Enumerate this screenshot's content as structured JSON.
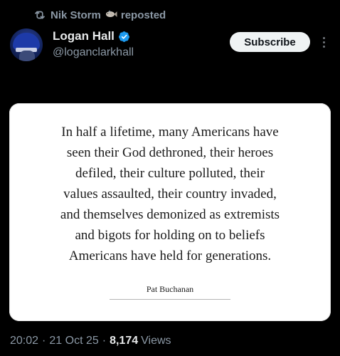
{
  "repost": {
    "user": "Nik Storm",
    "label": "reposted",
    "icon": "repost-icon",
    "emoji_icon": "fish-icon",
    "color": "#8b98a5"
  },
  "author": {
    "display_name": "Logan Hall",
    "handle": "@loganclarkhall",
    "verified_badge": "verified-badge-icon",
    "badge_color": "#1d9bf0"
  },
  "actions": {
    "subscribe_label": "Subscribe",
    "more_icon": "more-options-icon"
  },
  "image": {
    "quote_lines": [
      "In half a lifetime, many Americans have",
      "seen their God dethroned, their heroes",
      "defiled, their culture polluted, their",
      "values assaulted, their country invaded,",
      "and themselves demonized as extremists",
      "and bigots for holding on to beliefs",
      "Americans have held for generations."
    ],
    "attribution": "Pat Buchanan"
  },
  "meta": {
    "time": "20:02",
    "separator": "·",
    "date": "21 Oct 25",
    "views_count": "8,174",
    "views_label": "Views"
  },
  "colors": {
    "background": "#000000",
    "primary_text": "#e7e9ea",
    "secondary_text": "#8b98a5",
    "button_bg": "#eff3f4"
  }
}
